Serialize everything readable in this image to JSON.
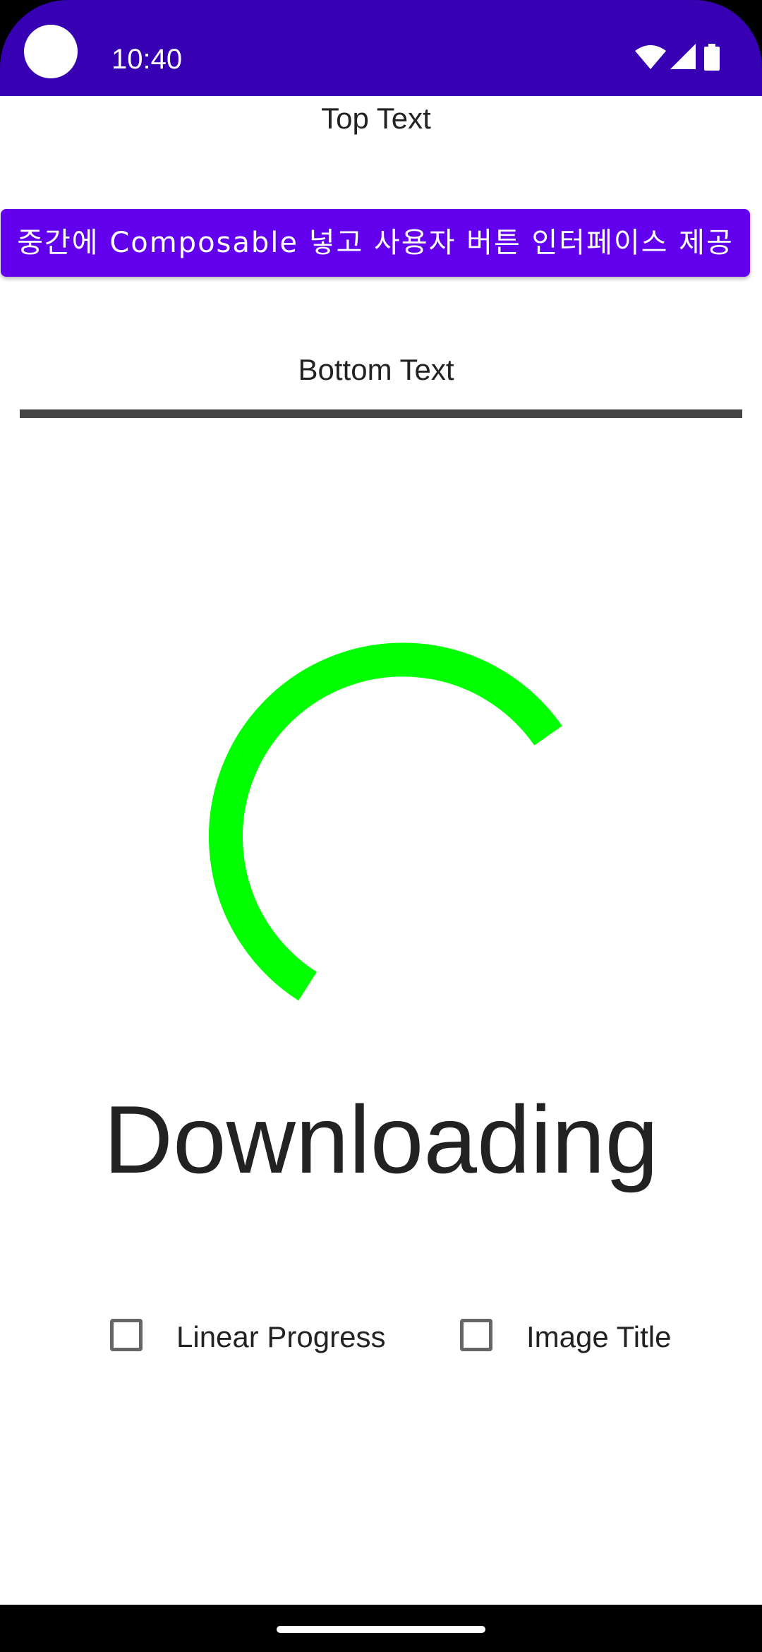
{
  "status_bar": {
    "time": "10:40",
    "icons": [
      "wifi-icon",
      "signal-icon",
      "battery-icon"
    ],
    "background": "#3700B3"
  },
  "screen": {
    "top_text": "Top Text",
    "button_label": "중간에 Composable 넣고 사용자 버튼 인터페이스 제공",
    "button_color": "#6200EE",
    "bottom_text": "Bottom Text",
    "divider_color": "#444444",
    "spinner_color": "#00FF00",
    "downloading_label": "Downloading",
    "checkboxes": [
      {
        "label": "Linear Progress",
        "checked": false
      },
      {
        "label": "Image Title",
        "checked": false
      }
    ]
  }
}
